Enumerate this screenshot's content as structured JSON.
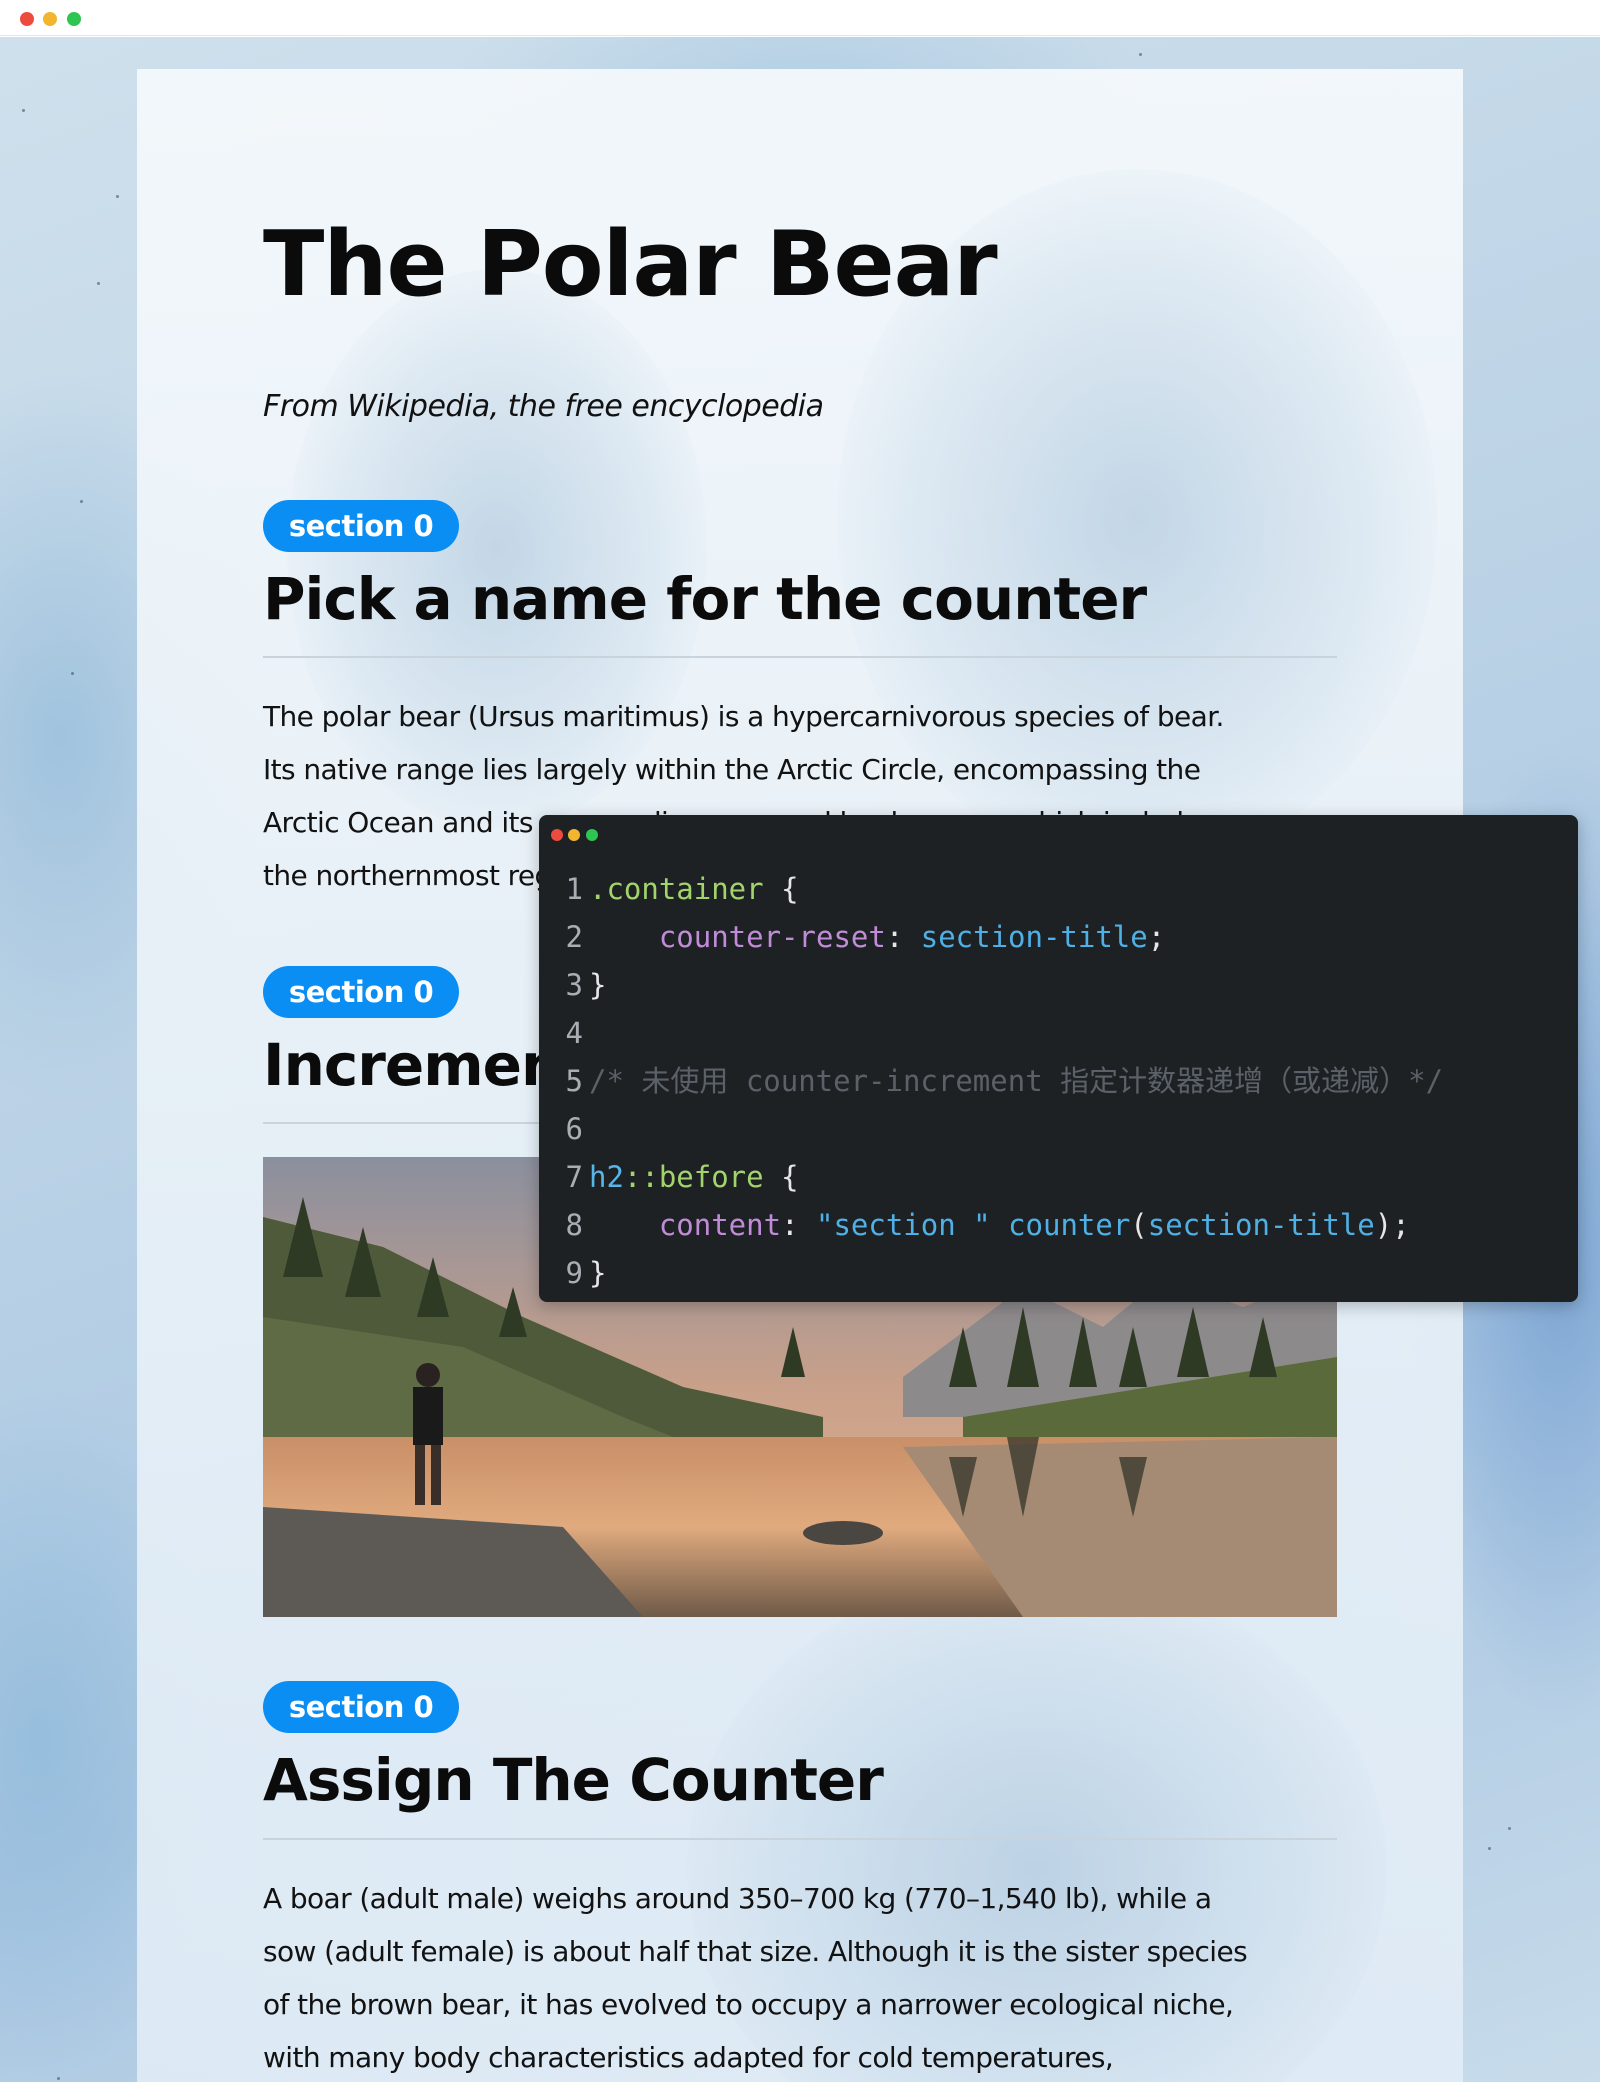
{
  "article": {
    "title": "The Polar Bear",
    "subtitle": "From Wikipedia, the free encyclopedia"
  },
  "sections": [
    {
      "badge": "section 0",
      "heading": "Pick a name for the counter",
      "lines": [
        "The polar bear (Ursus maritimus) is a hypercarnivorous species of bear.",
        "Its native range lies largely within the Arctic Circle, encompassing the",
        "Arctic Ocean and its surrounding seas and landmasses, which includes",
        "the northernmost regions of North America and Eurasia"
      ]
    },
    {
      "badge": "section 0",
      "heading": "Increment the counter"
    },
    {
      "badge": "section 0",
      "heading": "Assign The Counter",
      "lines": [
        "A boar (adult male) weighs around 350–700 kg (770–1,540 lb), while a",
        "sow (adult female) is about half that size. Although it is the sister species",
        "of the brown bear, it has evolved to occupy a narrower ecological niche,",
        "with many body characteristics adapted for cold temperatures,"
      ]
    }
  ],
  "code": {
    "line_numbers": [
      "1",
      "2",
      "3",
      "4",
      "5",
      "6",
      "7",
      "8",
      "9"
    ],
    "l1_selector": ".container",
    "l1_brace": " {",
    "l2_indent": "    ",
    "l2_prop": "counter-reset",
    "l2_colon": ": ",
    "l2_value": "section-title",
    "l2_semi": ";",
    "l3_close": "}",
    "l5_comment": "/* 未使用 counter-increment 指定计数器递增（或递减）*/",
    "l7_tag": "h2",
    "l7_pseudo": "::before",
    "l7_brace": " {",
    "l8_indent": "    ",
    "l8_prop": "content",
    "l8_colon": ": ",
    "l8_string": "\"section \"",
    "l8_space": " ",
    "l8_func": "counter",
    "l8_open": "(",
    "l8_arg": "section-title",
    "l8_close": ");",
    "l9_close": "}"
  },
  "colors": {
    "badge": "#0a8ef3",
    "code_bg": "#1e2124",
    "selector": "#a3d36b",
    "property": "#c08cd8",
    "value": "#4fb0e6"
  }
}
